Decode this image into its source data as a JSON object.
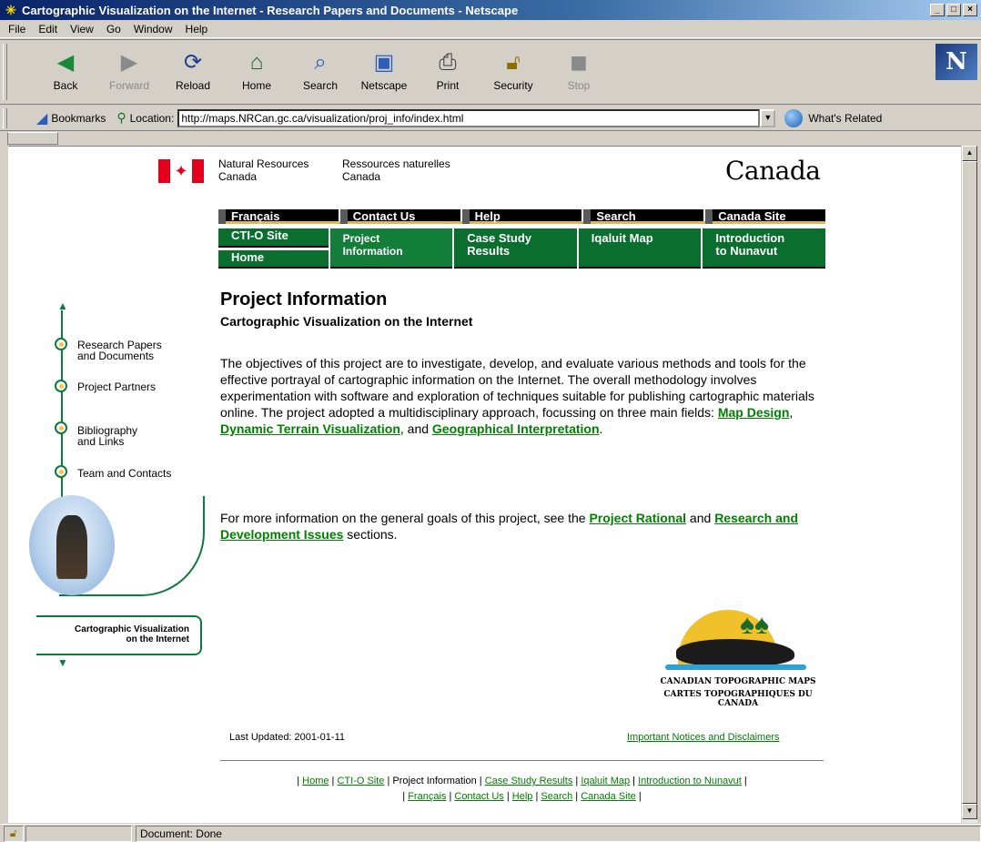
{
  "window": {
    "title": "Cartographic Visualization on the Internet - Research Papers and Documents - Netscape"
  },
  "menu": [
    "File",
    "Edit",
    "View",
    "Go",
    "Window",
    "Help"
  ],
  "toolbar": {
    "back": "Back",
    "forward": "Forward",
    "reload": "Reload",
    "home": "Home",
    "search": "Search",
    "netscape": "Netscape",
    "print": "Print",
    "security": "Security",
    "stop": "Stop",
    "brand": "N"
  },
  "locationbar": {
    "bookmarks": "Bookmarks",
    "location_label": "Location:",
    "url": "http://maps.NRCan.gc.ca/visualization/proj_info/index.html",
    "whats_related": "What's Related"
  },
  "header": {
    "dept_en_1": "Natural Resources",
    "dept_en_2": "Canada",
    "dept_fr_1": "Ressources naturelles",
    "dept_fr_2": "Canada",
    "wordmark": "Canada"
  },
  "nav": {
    "row1": [
      "Français",
      "Contact Us",
      "Help",
      "Search",
      "Canada Site"
    ],
    "ctio": "CTI-O Site",
    "home": "Home",
    "project_info": "Project\nInformation",
    "case_study": "Case Study\nResults",
    "iqaluit": "Iqaluit Map",
    "nunavut": "Introduction\nto Nunavut"
  },
  "sidebar": {
    "items": [
      "Research Papers\nand Documents",
      "Project Partners",
      "Bibliography\nand Links",
      "Team and Contacts"
    ],
    "banner_1": "Cartographic Visualization",
    "banner_2": "on the Internet"
  },
  "main": {
    "title": "Project Information",
    "subtitle": "Cartographic Visualization on the Internet",
    "para1": "The objectives of this project are to investigate, develop, and evaluate various methods and tools for the effective portrayal of cartographic information on the Internet. The overall methodology involves experimentation with software and exploration of techniques suitable for publishing cartographic materials online. The project adopted a multidisciplinary approach, focussing on three main fields: ",
    "link_map_design": "Map Design",
    "link_dynamic": "Dynamic Terrain Visualization",
    "link_geo": "Geographical Interpretation",
    "para2_pre": "For more information on the general goals of this project, see the ",
    "link_rational": "Project Rational",
    "link_rd": "Research and Development Issues",
    "para2_post": " sections."
  },
  "topo": {
    "line_en": "CANADIAN TOPOGRAPHIC MAPS",
    "line_fr": "CARTES TOPOGRAPHIQUES DU CANADA"
  },
  "footer": {
    "updated": "Last Updated: 2001-01-11",
    "notices": "Important Notices and Disclaimers",
    "row1": [
      "Home",
      "CTI-O Site",
      "Project Information",
      "Case Study Results",
      "Iqaluit Map",
      "Introduction to Nunavut"
    ],
    "row2": [
      "Français",
      "Contact Us",
      "Help",
      "Search",
      "Canada Site"
    ]
  },
  "status": {
    "message": "Document: Done"
  },
  "colors": {
    "nav_green": "#0a6e2e",
    "link_green": "#008000",
    "flag_red": "#e4001b",
    "nav_accent": "#e2b94f"
  }
}
